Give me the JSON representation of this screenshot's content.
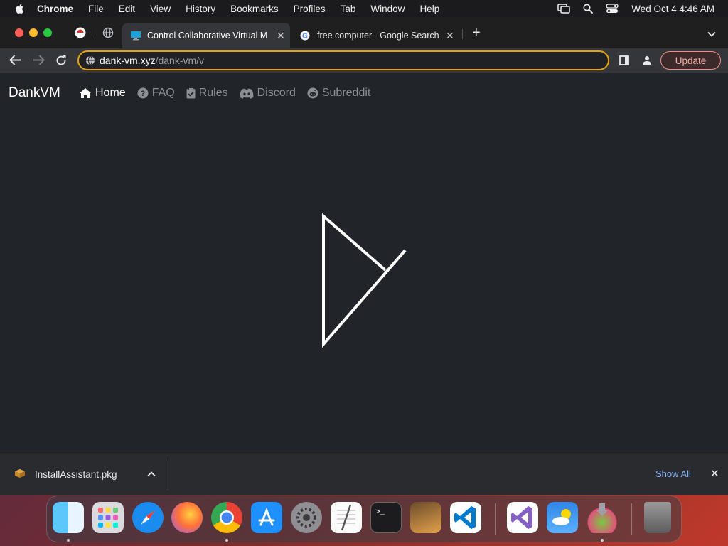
{
  "menubar": {
    "app": "Chrome",
    "items": [
      "File",
      "Edit",
      "View",
      "History",
      "Bookmarks",
      "Profiles",
      "Tab",
      "Window",
      "Help"
    ],
    "clock": "Wed Oct 4  4:46 AM"
  },
  "tabs": [
    {
      "title": "Control Collaborative Virtual M",
      "active": true
    },
    {
      "title": "free computer - Google Search",
      "active": false
    }
  ],
  "omnibox": {
    "host": "dank-vm.xyz",
    "path": "/dank-vm/v"
  },
  "update_label": "Update",
  "site": {
    "brand": "DankVM",
    "nav": [
      {
        "label": "Home",
        "icon": "home-icon",
        "active": true
      },
      {
        "label": "FAQ",
        "icon": "question-circle-icon",
        "active": false
      },
      {
        "label": "Rules",
        "icon": "clipboard-check-icon",
        "active": false
      },
      {
        "label": "Discord",
        "icon": "discord-icon",
        "active": false
      },
      {
        "label": "Subreddit",
        "icon": "reddit-icon",
        "active": false
      }
    ]
  },
  "downloads": {
    "file": "InstallAssistant.pkg",
    "show_all": "Show All"
  },
  "dock": [
    "finder",
    "launchpad",
    "safari",
    "firefox",
    "chrome",
    "app-store",
    "system-preferences",
    "textedit",
    "terminal",
    "garageband",
    "vscode",
    "visual-studio",
    "weather",
    "disk-utility",
    "trash"
  ],
  "colors": {
    "accent_outline": "#e5a50a",
    "update": "#f28b82",
    "link": "#8ab4f8",
    "page_bg": "#212529"
  }
}
